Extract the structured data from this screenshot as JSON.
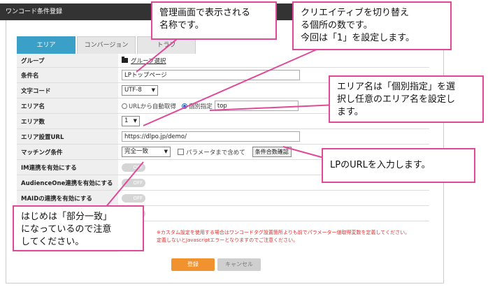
{
  "window_title": "ワンコード条件登録",
  "tabs": [
    "エリア",
    "コンバージョン",
    "トラフ"
  ],
  "form": {
    "group": {
      "label": "グループ",
      "value": "グループ選択"
    },
    "condition_name": {
      "label": "条件名",
      "value": "LPトップページ"
    },
    "charset": {
      "label": "文字コード",
      "value": "UTF-8"
    },
    "area_name": {
      "label": "エリア名",
      "option1": "URLから自動取得",
      "option2": "個別指定",
      "value": "top"
    },
    "area_count": {
      "label": "エリア数",
      "value": "1"
    },
    "area_url": {
      "label": "エリア設置URL",
      "value": "https://dlpo.jp/demo/"
    },
    "matching": {
      "label": "マッチング条件",
      "value": "完全一致",
      "param_label": "パラメータまで含めて",
      "check_button": "条件合数確認"
    },
    "im_link": {
      "label": "IM連携を有効にする",
      "toggle": "OFF"
    },
    "audience_one": {
      "label": "AudienceOne連携を有効にする",
      "toggle": "OFF"
    },
    "extra_row": {
      "label": "MAIDの連携を有効にする",
      "toggle": "OFF"
    },
    "row_blank": {
      "label": "",
      "toggle": ""
    },
    "notes": [
      "※カスタム設定を使用する場合はワンコードタグ設置箇所よりも前でパラメーター値取得変数を定義してください。",
      "定義しないとJavascriptエラーとなりますのでご注意ください。"
    ]
  },
  "buttons": {
    "save": "登録",
    "cancel": "キャンセル"
  },
  "callouts": {
    "c1": "管理画面で表示される\n名称です。",
    "c2": "クリエイティブを切り替え\nる個所の数です。\n今回は「1」を設定します。",
    "c3": "エリア名は「個別指定」を選\n択し任意のエリア名を設定し\nます。",
    "c4": "LPのURLを入力します。",
    "c5": "はじめは「部分一致」\nになっているので注意\nしてください。"
  },
  "colors": {
    "accent_tab": "#3aa0c8",
    "callout_border": "#e0499a",
    "save_button": "#f0922d",
    "note_red": "#e03030"
  }
}
